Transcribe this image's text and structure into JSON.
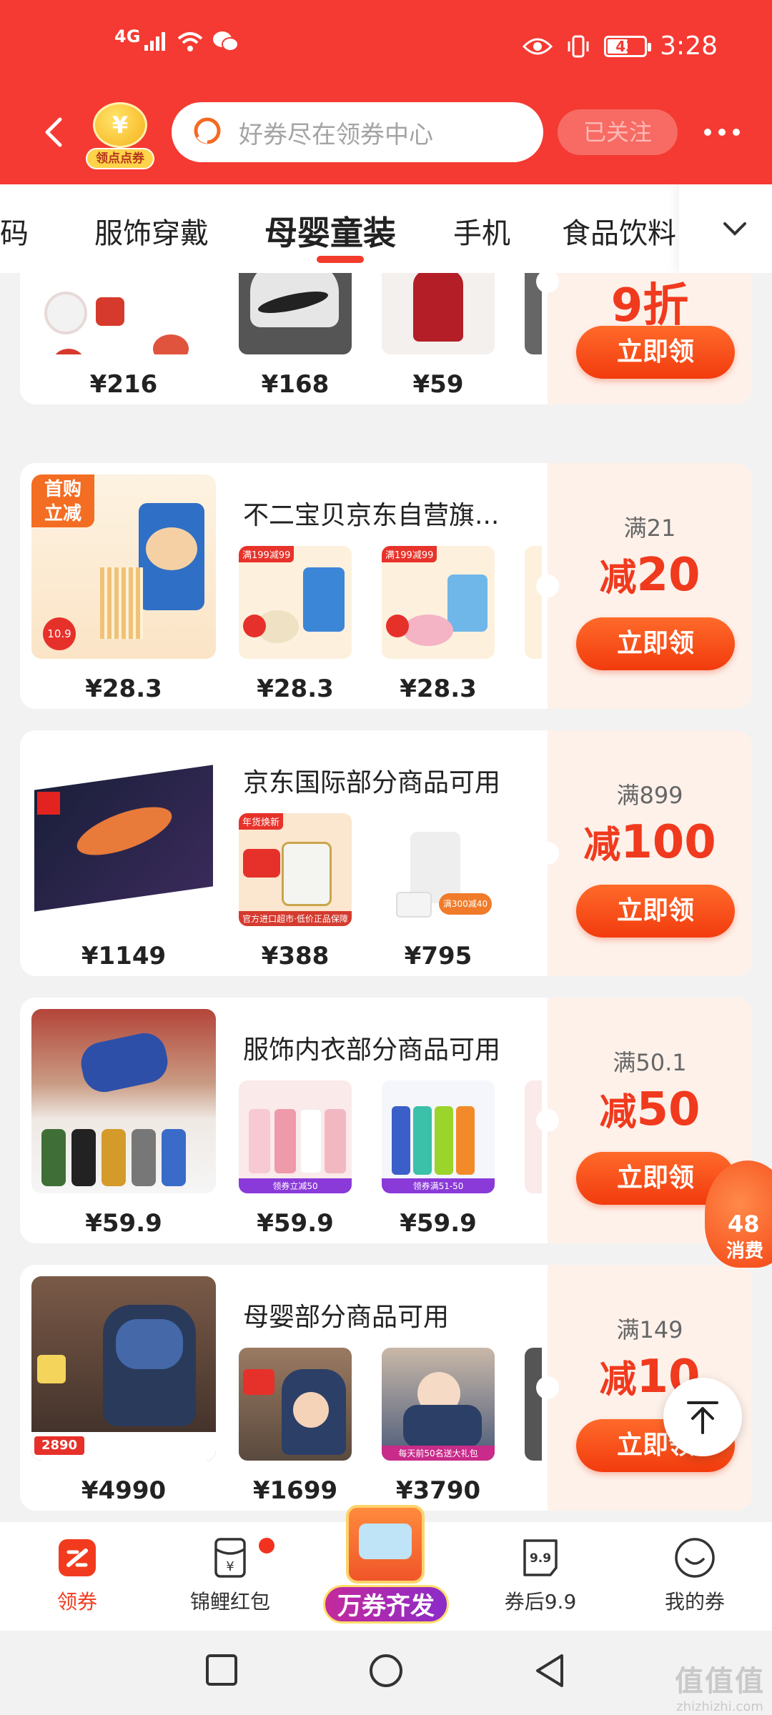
{
  "status_bar": {
    "network": "4G",
    "battery": "43",
    "time": "3:28"
  },
  "header": {
    "points_coin": "¥",
    "points_label": "领点点券",
    "search_placeholder": "好券尽在领券中心",
    "follow_label": "已关注"
  },
  "tabs": [
    {
      "label": "数码"
    },
    {
      "label": "服饰穿戴"
    },
    {
      "label": "母婴童装"
    },
    {
      "label": "手机"
    },
    {
      "label": "食品饮料"
    }
  ],
  "cards": [
    {
      "title": "",
      "threshold": "",
      "discount_prefix": "",
      "discount_value": "9折",
      "claim_label": "立即领",
      "prices": [
        "¥216",
        "¥168",
        "¥59"
      ]
    },
    {
      "badge": "首购立减",
      "title": "不二宝贝京东自营旗...",
      "threshold": "满21",
      "discount_prefix": "减",
      "discount_value": "20",
      "claim_label": "立即领",
      "prices": [
        "¥28.3",
        "¥28.3",
        "¥28.3"
      ]
    },
    {
      "title": "京东国际部分商品可用",
      "threshold": "满899",
      "discount_prefix": "减",
      "discount_value": "100",
      "claim_label": "立即领",
      "prices": [
        "¥1149",
        "¥388",
        "¥795"
      ]
    },
    {
      "title": "服饰内衣部分商品可用",
      "threshold": "满50.1",
      "discount_prefix": "减",
      "discount_value": "50",
      "claim_label": "立即领",
      "prices": [
        "¥59.9",
        "¥59.9",
        "¥59.9"
      ]
    },
    {
      "title": "母婴部分商品可用",
      "threshold": "满149",
      "discount_prefix": "减",
      "discount_value": "10",
      "claim_label": "立即领",
      "prices": [
        "¥4990",
        "¥1699",
        "¥3790"
      ]
    }
  ],
  "floating": {
    "red_packet_num": "48",
    "red_packet_label": "消费"
  },
  "bottom_tabs": [
    {
      "label": "领券"
    },
    {
      "label": "锦鲤红包"
    },
    {
      "label": "万券齐发"
    },
    {
      "label": "券后9.9"
    },
    {
      "label": "我的券"
    }
  ],
  "bottom_icons": {
    "jinli": "¥",
    "quanhou": "9.9"
  },
  "watermark": {
    "main": "值值值",
    "sub": "zhizhizhi.com"
  },
  "colors": {
    "brand_red": "#f43a32",
    "accent_orange": "#f23b0e",
    "discount_red": "#f03a1e"
  }
}
